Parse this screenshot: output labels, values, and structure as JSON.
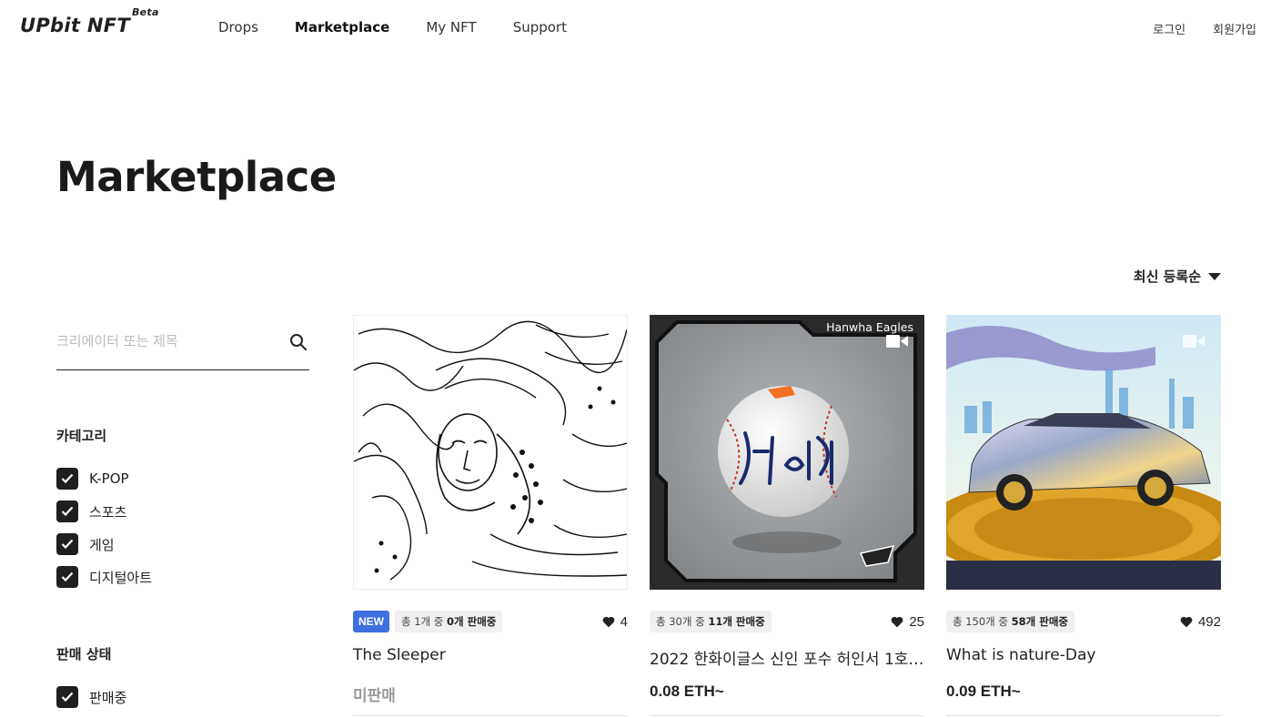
{
  "header": {
    "logo": "UPbit NFT",
    "logo_beta": "Beta",
    "nav": [
      "Drops",
      "Marketplace",
      "My NFT",
      "Support"
    ],
    "active_nav": "Marketplace",
    "login": "로그인",
    "signup": "회원가입"
  },
  "page": {
    "title": "Marketplace",
    "sort_label": "최신 등록순"
  },
  "sidebar": {
    "search_placeholder": "크리에이터 또는 제목",
    "category_title": "카테고리",
    "categories": [
      "K-POP",
      "스포츠",
      "게임",
      "디지털아트"
    ],
    "status_title": "판매 상태",
    "statuses": [
      "판매중"
    ]
  },
  "cards": [
    {
      "badge": "NEW",
      "sale_prefix": "총 1개 중 ",
      "sale_count": "0개 판매중",
      "likes": "4",
      "title": "The Sleeper",
      "price": "미판매"
    },
    {
      "badge": "",
      "brand_label": "Hanwha Eagles",
      "sale_prefix": "총 30개 중 ",
      "sale_count": "11개 판매중",
      "likes": "25",
      "title": "2022 한화이글스 신인 포수 허인서 1호…",
      "price": "0.08 ETH~"
    },
    {
      "badge": "",
      "sale_prefix": "총 150개 중 ",
      "sale_count": "58개 판매중",
      "likes": "492",
      "title": "What is nature-Day",
      "price": "0.09 ETH~"
    }
  ],
  "colors": {
    "new_badge": "#3d6fe0",
    "text": "#222222",
    "muted": "#999999"
  }
}
